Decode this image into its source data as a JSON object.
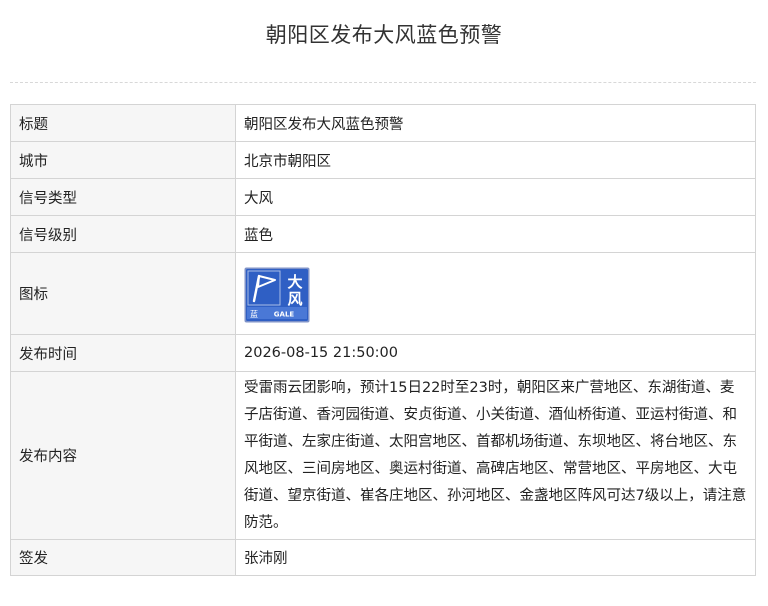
{
  "page": {
    "title": "朝阳区发布大风蓝色预警"
  },
  "details": {
    "rows": [
      {
        "label": "标题",
        "value": "朝阳区发布大风蓝色预警"
      },
      {
        "label": "城市",
        "value": "北京市朝阳区"
      },
      {
        "label": "信号类型",
        "value": "大风"
      },
      {
        "label": "信号级别",
        "value": "蓝色"
      },
      {
        "label": "图标"
      },
      {
        "label": "发布时间",
        "value": "2026-08-15 21:50:00"
      },
      {
        "label": "发布内容",
        "value": "受雷雨云团影响，预计15日22时至23时，朝阳区来广营地区、东湖街道、麦子店街道、香河园街道、安贞街道、小关街道、酒仙桥街道、亚运村街道、和平街道、左家庄街道、太阳宫地区、首都机场街道、东坝地区、将台地区、东风地区、三间房地区、奥运村街道、高碑店地区、常营地区、平房地区、大屯街道、望京街道、崔各庄地区、孙河地区、金盏地区阵风可达7级以上，请注意防范。"
      },
      {
        "label": "签发",
        "value": "张沛刚"
      }
    ]
  },
  "warning_icon": {
    "icon": "gale-warning-icon",
    "main_text": "大风",
    "level_text": "蓝",
    "english_text": "GALE",
    "colors": {
      "background": "#2f5fc4",
      "border": "#7f93c8",
      "text": "#ffffff"
    }
  }
}
